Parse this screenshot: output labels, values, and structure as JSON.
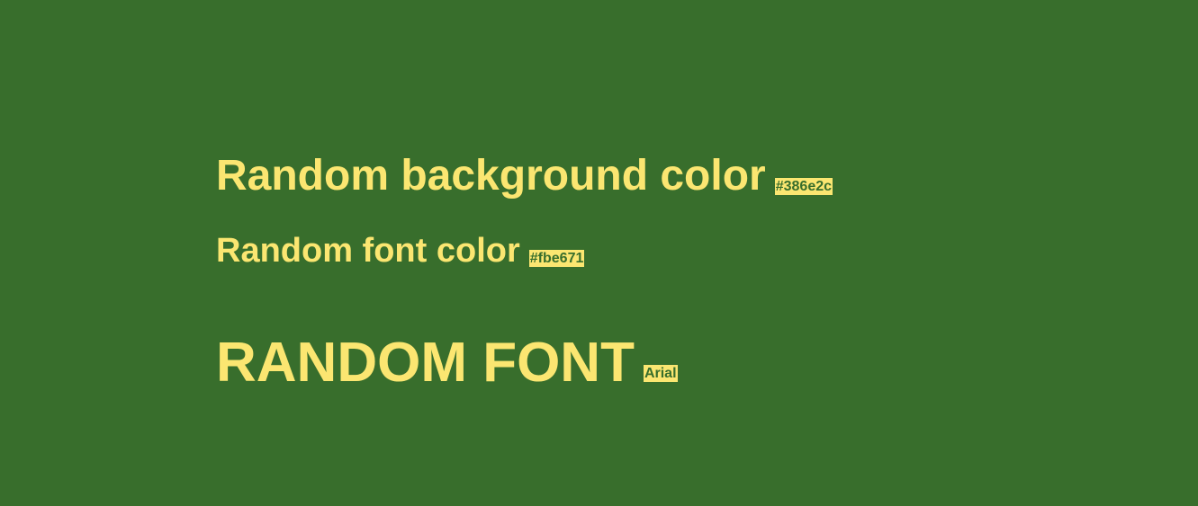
{
  "colors": {
    "background": "#386e2c",
    "font": "#fbe671"
  },
  "lines": [
    {
      "label": "Random background color",
      "badge": "#386e2c"
    },
    {
      "label": "Random font color",
      "badge": "#fbe671"
    },
    {
      "label": "RANDOM FONT",
      "badge": "Arial"
    }
  ]
}
